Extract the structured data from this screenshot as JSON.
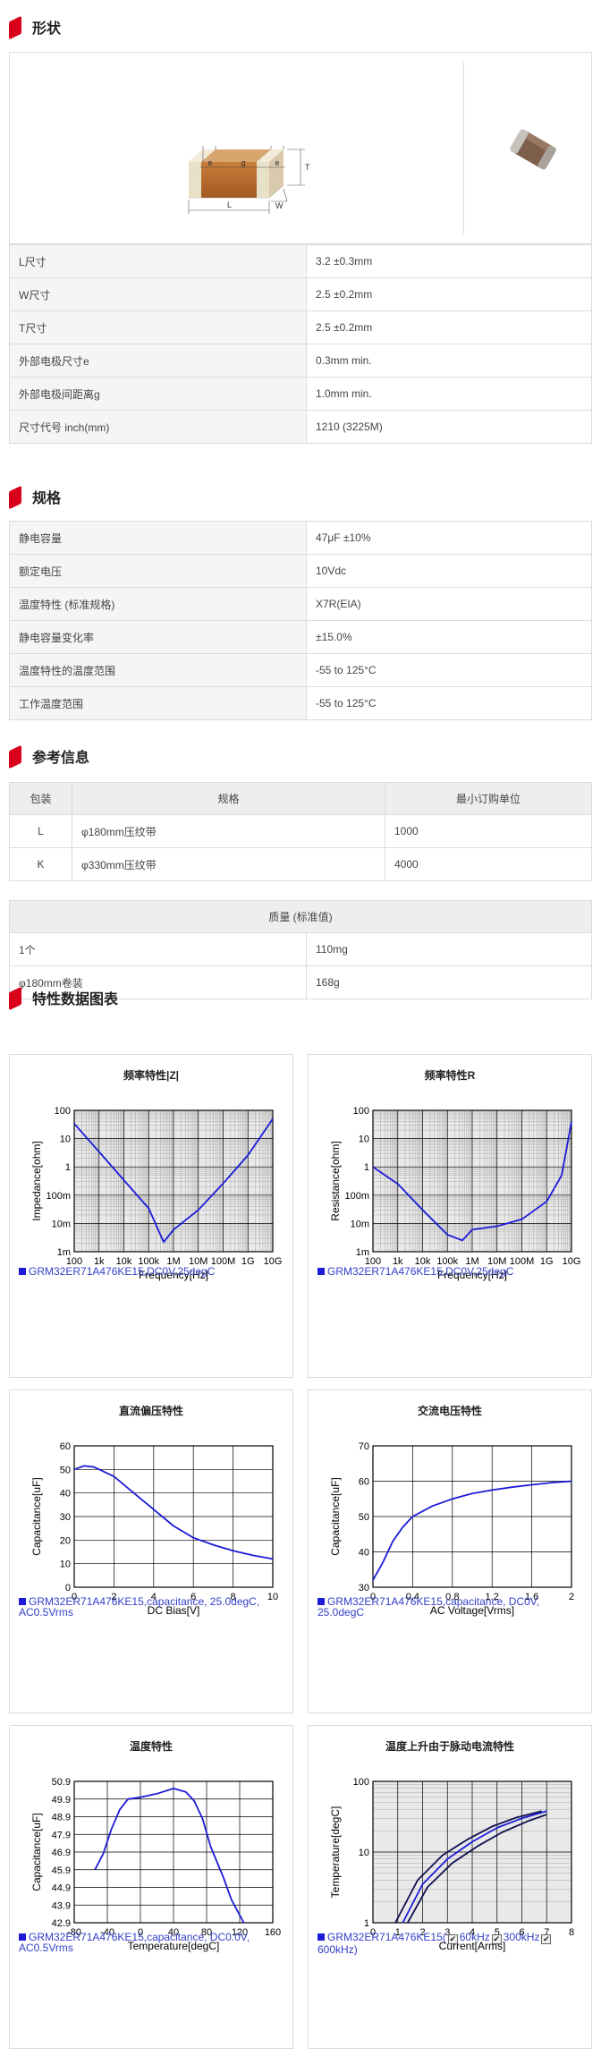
{
  "sections": {
    "shape": "形状",
    "spec": "规格",
    "reference": "参考信息",
    "charts": "特性数据图表"
  },
  "shape": {
    "dim_labels": {
      "e1": "e",
      "g": "g",
      "e2": "e",
      "T": "T",
      "L": "L",
      "W": "W"
    },
    "rows": [
      {
        "label": "L尺寸",
        "value": "3.2 ±0.3mm"
      },
      {
        "label": "W尺寸",
        "value": "2.5 ±0.2mm"
      },
      {
        "label": "T尺寸",
        "value": "2.5 ±0.2mm"
      },
      {
        "label": "外部电极尺寸e",
        "value": "0.3mm min."
      },
      {
        "label": "外部电极间距离g",
        "value": "1.0mm min."
      },
      {
        "label": "尺寸代号 inch(mm)",
        "value": "1210 (3225M)"
      }
    ]
  },
  "spec": {
    "rows": [
      {
        "label": "静电容量",
        "value": "47μF ±10%"
      },
      {
        "label": "额定电压",
        "value": "10Vdc"
      },
      {
        "label": "温度特性 (标准规格)",
        "value": "X7R(EIA)"
      },
      {
        "label": "静电容量变化率",
        "value": "±15.0%"
      },
      {
        "label": "温度特性的温度范围",
        "value": "-55 to 125°C"
      },
      {
        "label": "工作温度范围",
        "value": "-55 to 125°C"
      }
    ]
  },
  "packaging": {
    "headers": [
      "包装",
      "规格",
      "最小订购单位"
    ],
    "rows": [
      {
        "code": "L",
        "spec": "φ180mm压纹带",
        "moq": "1000"
      },
      {
        "code": "K",
        "spec": "φ330mm压纹带",
        "moq": "4000"
      }
    ]
  },
  "mass": {
    "header": "质量 (标准值)",
    "rows": [
      {
        "label": "1个",
        "value": "110mg"
      },
      {
        "label": "φ180mm卷装",
        "value": "168g"
      }
    ]
  },
  "charts": [
    {
      "title": "频率特性|Z|",
      "legend": "GRM32ER71A476KE15,DC0V,25degC",
      "chart_data": {
        "type": "line",
        "xlabel": "Frequency[Hz]",
        "ylabel": "Impedance[ohm]",
        "xscale": "log",
        "yscale": "log",
        "xticks": [
          "100",
          "1k",
          "10k",
          "100k",
          "1M",
          "10M",
          "100M",
          "1G",
          "10G"
        ],
        "yticks": [
          "100",
          "10",
          "1",
          "100m",
          "10m",
          "1m"
        ],
        "series": [
          {
            "name": "GRM32ER71A476KE15,DC0V,25degC",
            "color": "#1b1bd8",
            "x": [
              100,
              1000,
              10000,
              100000,
              400000,
              1000000,
              10000000,
              100000000,
              1000000000,
              10000000000
            ],
            "y": [
              34,
              3.4,
              0.34,
              0.034,
              0.0022,
              0.006,
              0.03,
              0.26,
              2.6,
              50
            ]
          }
        ]
      }
    },
    {
      "title": "频率特性R",
      "legend": "GRM32ER71A476KE15,DC0V,25degC",
      "chart_data": {
        "type": "line",
        "xlabel": "Frequency[Hz]",
        "ylabel": "Resistance[ohm]",
        "xscale": "log",
        "yscale": "log",
        "xticks": [
          "100",
          "1k",
          "10k",
          "100k",
          "1M",
          "10M",
          "100M",
          "1G",
          "10G"
        ],
        "yticks": [
          "100",
          "10",
          "1",
          "100m",
          "10m",
          "1m"
        ],
        "series": [
          {
            "name": "GRM32ER71A476KE15,DC0V,25degC",
            "color": "#1b1bd8",
            "x": [
              100,
              1000,
              10000,
              100000,
              400000,
              1000000,
              10000000,
              100000000,
              1000000000,
              4000000000,
              10000000000
            ],
            "y": [
              1.0,
              0.25,
              0.03,
              0.004,
              0.0025,
              0.006,
              0.008,
              0.014,
              0.06,
              0.5,
              40
            ]
          }
        ]
      }
    },
    {
      "title": "直流偏压特性",
      "legend": "GRM32ER71A476KE15,capacitance, 25.0degC, AC0.5Vrms",
      "chart_data": {
        "type": "line",
        "xlabel": "DC Bias[V]",
        "ylabel": "Capacitance[uF]",
        "xticks": [
          "0",
          "2",
          "4",
          "6",
          "8",
          "10"
        ],
        "yticks": [
          "60",
          "50",
          "40",
          "30",
          "20",
          "10",
          "0"
        ],
        "xlim": [
          0,
          10
        ],
        "ylim": [
          0,
          60
        ],
        "series": [
          {
            "name": "GRM32ER71A476KE15,capacitance, 25.0degC, AC0.5Vrms",
            "color": "#1b1bd8",
            "x": [
              0,
              0.5,
              1,
              2,
              3,
              4,
              5,
              6,
              7,
              8,
              9,
              10
            ],
            "y": [
              50,
              51.5,
              51,
              47,
              40,
              33,
              26,
              21,
              18,
              15.5,
              13.5,
              12
            ]
          }
        ]
      }
    },
    {
      "title": "交流电压特性",
      "legend": "GRM32ER71A476KE15,capacitance, DC0V, 25.0degC",
      "chart_data": {
        "type": "line",
        "xlabel": "AC Voltage[Vrms]",
        "ylabel": "Capacitance[uF]",
        "xticks": [
          "0",
          "0.4",
          "0.8",
          "1.2",
          "1.6",
          "2"
        ],
        "yticks": [
          "70",
          "60",
          "50",
          "40",
          "30"
        ],
        "xlim": [
          0,
          2
        ],
        "ylim": [
          30,
          70
        ],
        "series": [
          {
            "name": "GRM32ER71A476KE15,capacitance, DC0V, 25.0degC",
            "color": "#1b1bd8",
            "x": [
              0,
              0.1,
              0.2,
              0.3,
              0.4,
              0.6,
              0.8,
              1.0,
              1.2,
              1.4,
              1.6,
              1.8,
              2.0
            ],
            "y": [
              32,
              37,
              43,
              47,
              50,
              53,
              55,
              56.5,
              57.5,
              58.3,
              59,
              59.6,
              60
            ]
          }
        ]
      }
    },
    {
      "title": "温度特性",
      "legend": "GRM32ER71A476KE15,capacitance, DC0.0V, AC0.5Vrms",
      "chart_data": {
        "type": "line",
        "xlabel": "Temperature[degC]",
        "ylabel": "Capacitance[uF]",
        "xticks": [
          "-80",
          "-40",
          "0",
          "40",
          "80",
          "120",
          "160"
        ],
        "yticks": [
          "50.9",
          "49.9",
          "48.9",
          "47.9",
          "46.9",
          "45.9",
          "44.9",
          "43.9",
          "42.9"
        ],
        "xlim": [
          -80,
          160
        ],
        "ylim": [
          42.9,
          50.9
        ],
        "series": [
          {
            "name": "GRM32ER71A476KE15,capacitance, DC0.0V, AC0.5Vrms",
            "color": "#1b1bd8",
            "x": [
              -55,
              -45,
              -35,
              -25,
              -15,
              0,
              20,
              40,
              55,
              65,
              75,
              85,
              100,
              110,
              125
            ],
            "y": [
              45.9,
              46.8,
              48.2,
              49.3,
              49.9,
              50.0,
              50.2,
              50.5,
              50.3,
              49.8,
              48.8,
              47.2,
              45.5,
              44.2,
              42.9
            ]
          }
        ]
      }
    },
    {
      "title": "温度上升由于脉动电流特性",
      "legend": "GRM32ER71A476KE15(",
      "legend_options": [
        {
          "label": "60kHz",
          "checked": true
        },
        {
          "label": "300kHz",
          "checked": true
        },
        {
          "label": "600kHz)",
          "checked": true
        }
      ],
      "chart_data": {
        "type": "line",
        "xlabel": "Current[Arms]",
        "ylabel": "Temperature[degC]",
        "yscale": "log",
        "xticks": [
          "0",
          "1",
          "2",
          "3",
          "4",
          "5",
          "6",
          "7",
          "8"
        ],
        "yticks": [
          "100",
          "10",
          "1"
        ],
        "xlim": [
          0,
          8
        ],
        "ylim": [
          1,
          100
        ],
        "series": [
          {
            "name": "60kHz",
            "color": "#1b1bd8",
            "x": [
              1.2,
              2,
              3,
              4,
              5,
              6,
              7
            ],
            "y": [
              1,
              3.5,
              8,
              14,
              22,
              30,
              38
            ]
          },
          {
            "name": "300kHz",
            "color": "#101050",
            "x": [
              1.4,
              2.2,
              3.2,
              4.2,
              5.2,
              6.2,
              7
            ],
            "y": [
              1,
              3.2,
              7,
              12,
              19,
              27,
              34
            ]
          },
          {
            "name": "600kHz",
            "color": "#101050",
            "x": [
              0.9,
              1.8,
              2.8,
              3.8,
              4.8,
              5.8,
              6.8
            ],
            "y": [
              1,
              4,
              9,
              15,
              23,
              31,
              38
            ]
          }
        ]
      }
    }
  ]
}
